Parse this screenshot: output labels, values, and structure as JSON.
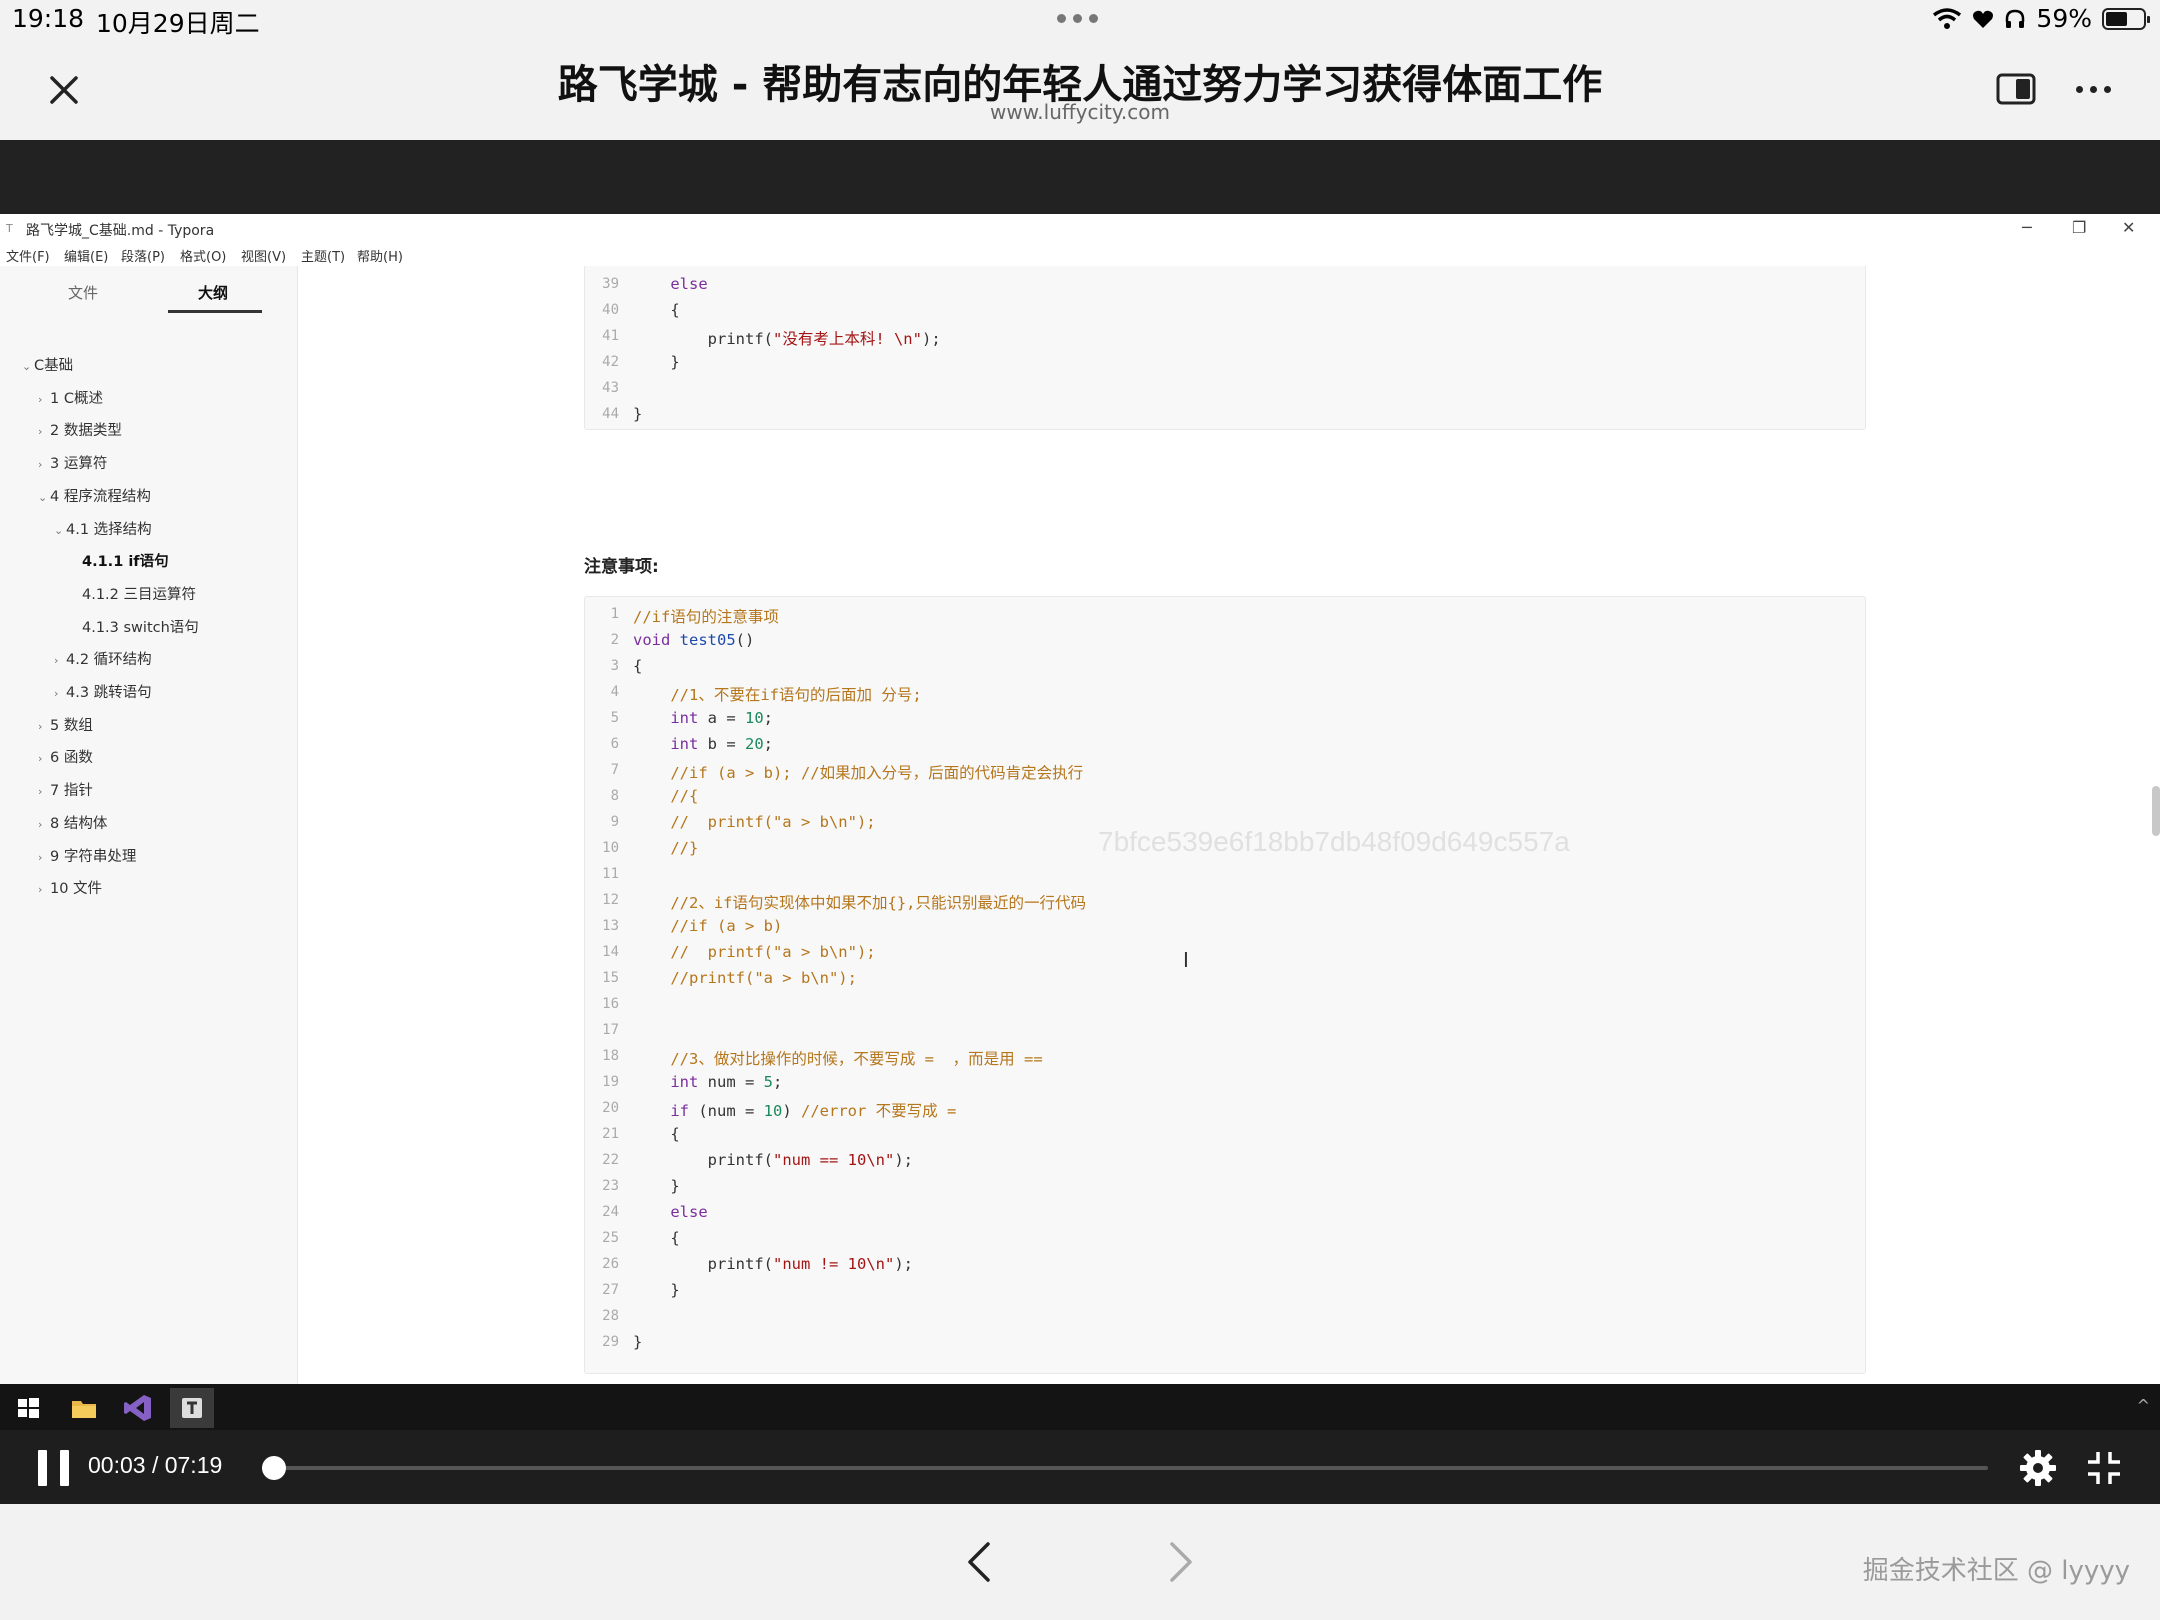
{
  "status_bar": {
    "time": "19:18",
    "date": "10月29日周二",
    "battery": "59%",
    "battery_level": 0.59
  },
  "browser": {
    "title": "路飞学城 - 帮助有志向的年轻人通过努力学习获得体面工作",
    "url": "www.luffycity.com"
  },
  "typora": {
    "window_title": "路飞学城_C基础.md - Typora",
    "menu": [
      "文件(F)",
      "编辑(E)",
      "段落(P)",
      "格式(O)",
      "视图(V)",
      "主题(T)",
      "帮助(H)"
    ],
    "sidebar_tabs": [
      "文件",
      "大纲"
    ],
    "outline": [
      {
        "label": "C基础",
        "caret": "open"
      },
      {
        "label": "1 C概述",
        "caret": "closed"
      },
      {
        "label": "2 数据类型",
        "caret": "closed"
      },
      {
        "label": "3 运算符",
        "caret": "closed"
      },
      {
        "label": "4 程序流程结构",
        "caret": "open"
      },
      {
        "label": "4.1 选择结构",
        "caret": "open"
      },
      {
        "label": "4.1.1 if语句",
        "caret": "none"
      },
      {
        "label": "4.1.2 三目运算符",
        "caret": "none"
      },
      {
        "label": "4.1.3 switch语句",
        "caret": "none"
      },
      {
        "label": "4.2 循环结构",
        "caret": "closed"
      },
      {
        "label": "4.3 跳转语句",
        "caret": "closed"
      },
      {
        "label": "5 数组",
        "caret": "closed"
      },
      {
        "label": "6 函数",
        "caret": "closed"
      },
      {
        "label": "7 指针",
        "caret": "closed"
      },
      {
        "label": "8 结构体",
        "caret": "closed"
      },
      {
        "label": "9 字符串处理",
        "caret": "closed"
      },
      {
        "label": "10 文件",
        "caret": "closed"
      }
    ],
    "heading": "注意事项:",
    "watermark": "7bfce539e6f18bb7db48f09d649c557a",
    "code_block_1": [
      {
        "n": "39",
        "code": "    else"
      },
      {
        "n": "40",
        "code": "    {"
      },
      {
        "n": "41",
        "code": "        printf(\"没有考上本科! \\n\");"
      },
      {
        "n": "42",
        "code": "    }"
      },
      {
        "n": "43",
        "code": ""
      },
      {
        "n": "44",
        "code": "}"
      }
    ],
    "code_block_2": [
      {
        "n": "1",
        "code": "//if语句的注意事项"
      },
      {
        "n": "2",
        "code": "void test05()"
      },
      {
        "n": "3",
        "code": "{"
      },
      {
        "n": "4",
        "code": "    //1、不要在if语句的后面加 分号;"
      },
      {
        "n": "5",
        "code": "    int a = 10;"
      },
      {
        "n": "6",
        "code": "    int b = 20;"
      },
      {
        "n": "7",
        "code": "    //if (a > b); //如果加入分号，后面的代码肯定会执行"
      },
      {
        "n": "8",
        "code": "    //{"
      },
      {
        "n": "9",
        "code": "    //  printf(\"a > b\\n\");"
      },
      {
        "n": "10",
        "code": "    //}"
      },
      {
        "n": "11",
        "code": ""
      },
      {
        "n": "12",
        "code": "    //2、if语句实现体中如果不加{},只能识别最近的一行代码"
      },
      {
        "n": "13",
        "code": "    //if (a > b)"
      },
      {
        "n": "14",
        "code": "    //  printf(\"a > b\\n\");"
      },
      {
        "n": "15",
        "code": "    //printf(\"a > b\\n\");"
      },
      {
        "n": "16",
        "code": ""
      },
      {
        "n": "17",
        "code": ""
      },
      {
        "n": "18",
        "code": "    //3、做对比操作的时候，不要写成 =  ，而是用 =="
      },
      {
        "n": "19",
        "code": "    int num = 5;"
      },
      {
        "n": "20",
        "code": "    if (num = 10) //error 不要写成 ="
      },
      {
        "n": "21",
        "code": "    {"
      },
      {
        "n": "22",
        "code": "        printf(\"num == 10\\n\");"
      },
      {
        "n": "23",
        "code": "    }"
      },
      {
        "n": "24",
        "code": "    else"
      },
      {
        "n": "25",
        "code": "    {"
      },
      {
        "n": "26",
        "code": "        printf(\"num != 10\\n\");"
      },
      {
        "n": "27",
        "code": "    }"
      },
      {
        "n": "28",
        "code": ""
      },
      {
        "n": "29",
        "code": "}"
      }
    ]
  },
  "video": {
    "time": "00:03 / 07:19",
    "progress": 0.0068
  },
  "footer": {
    "credit": "掘金技术社区 @ lyyyy"
  },
  "colors": {
    "keyword": "#7a2e9e",
    "comment": "#b5761c",
    "string": "#a31515",
    "number": "#1a8a5c"
  }
}
